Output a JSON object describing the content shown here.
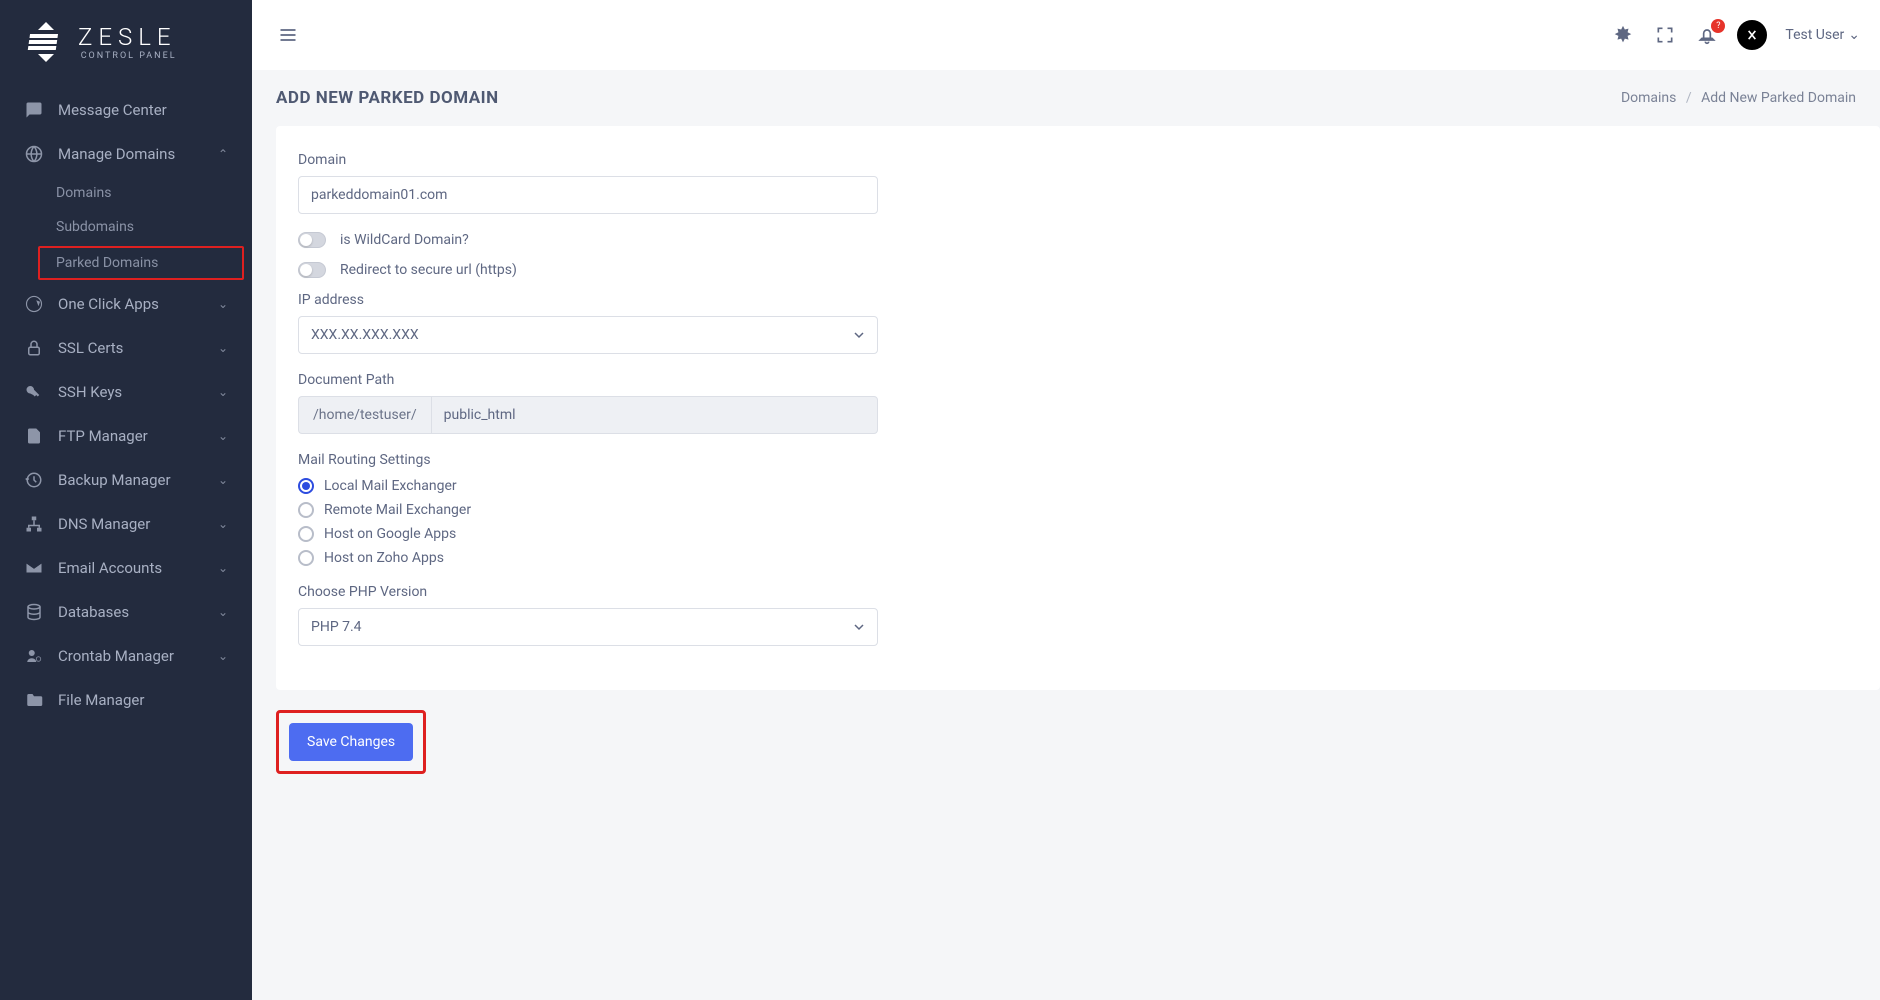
{
  "brand": {
    "title": "ZESLE",
    "subtitle": "CONTROL PANEL"
  },
  "sidebar": {
    "message_center": "Message Center",
    "manage_domains": "Manage Domains",
    "sub_domains": "Domains",
    "sub_subdomains": "Subdomains",
    "sub_parked": "Parked Domains",
    "one_click": "One Click Apps",
    "ssl": "SSL Certs",
    "ssh": "SSH Keys",
    "ftp": "FTP Manager",
    "backup": "Backup Manager",
    "dns": "DNS Manager",
    "email": "Email Accounts",
    "db": "Databases",
    "cron": "Crontab Manager",
    "file": "File Manager"
  },
  "topbar": {
    "badge": "?",
    "user": "Test User"
  },
  "page": {
    "title": "ADD NEW PARKED DOMAIN",
    "breadcrumb_root": "Domains",
    "breadcrumb_current": "Add New Parked Domain"
  },
  "form": {
    "domain_label": "Domain",
    "domain_value": "parkeddomain01.com",
    "wildcard_label": "is WildCard Domain?",
    "redirect_label": "Redirect to secure url (https)",
    "ip_label": "IP address",
    "ip_value": "XXX.XX.XXX.XXX",
    "docpath_label": "Document Path",
    "docpath_prefix": "/home/testuser/",
    "docpath_value": "public_html",
    "mail_label": "Mail Routing Settings",
    "mail_local": "Local Mail Exchanger",
    "mail_remote": "Remote Mail Exchanger",
    "mail_google": "Host on Google Apps",
    "mail_zoho": "Host on Zoho Apps",
    "php_label": "Choose PHP Version",
    "php_value": "PHP 7.4",
    "save": "Save Changes"
  }
}
